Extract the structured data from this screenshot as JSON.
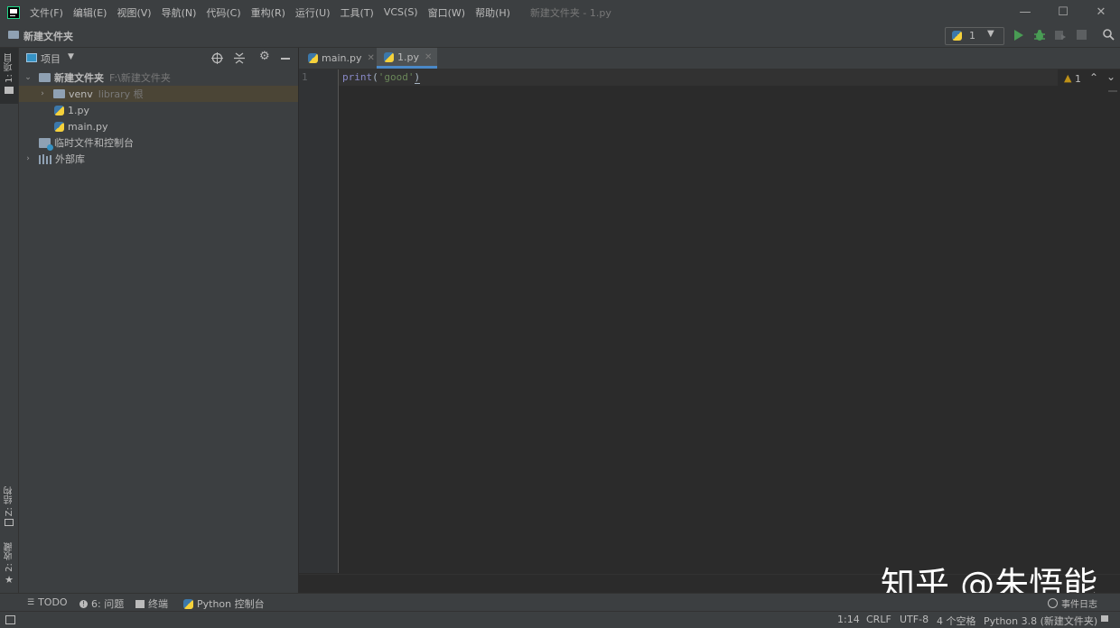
{
  "app": {
    "menu": [
      "文件(F)",
      "编辑(E)",
      "视图(V)",
      "导航(N)",
      "代码(C)",
      "重构(R)",
      "运行(U)",
      "工具(T)",
      "VCS(S)",
      "窗口(W)",
      "帮助(H)"
    ],
    "window_title": "新建文件夹 - 1.py"
  },
  "nav": {
    "breadcrumb": "新建文件夹",
    "run_config": "1"
  },
  "left_stripe": {
    "project": "1: 项目",
    "structure": "Z: 结构",
    "favorites": "2: 收藏"
  },
  "project": {
    "header": "项目",
    "root": {
      "name": "新建文件夹",
      "path": "F:\\新建文件夹"
    },
    "venv": {
      "name": "venv",
      "hint": "library 根"
    },
    "file_1": "1.py",
    "file_main": "main.py",
    "scratches": "临时文件和控制台",
    "external": "外部库"
  },
  "editor": {
    "tabs": [
      {
        "label": "main.py"
      },
      {
        "label": "1.py"
      }
    ],
    "line_number": "1",
    "code": {
      "fn": "print",
      "open": "(",
      "str": "'good'",
      "close": ")"
    },
    "inspection_count": "1"
  },
  "bottom_tools": {
    "todo": "TODO",
    "problems": "6: 问题",
    "terminal": "终端",
    "python_console": "Python 控制台",
    "event_log": "事件日志"
  },
  "status": {
    "position": "1:14",
    "line_sep": "CRLF",
    "encoding": "UTF-8",
    "indent": "4 个空格",
    "interpreter": "Python 3.8 (新建文件夹)"
  },
  "watermark": "知乎 @朱悟能",
  "colors": {
    "accent": "#4a88c7",
    "run": "#499c54",
    "keyword": "#8888c6",
    "string": "#6a8759",
    "warning": "#be9117"
  }
}
